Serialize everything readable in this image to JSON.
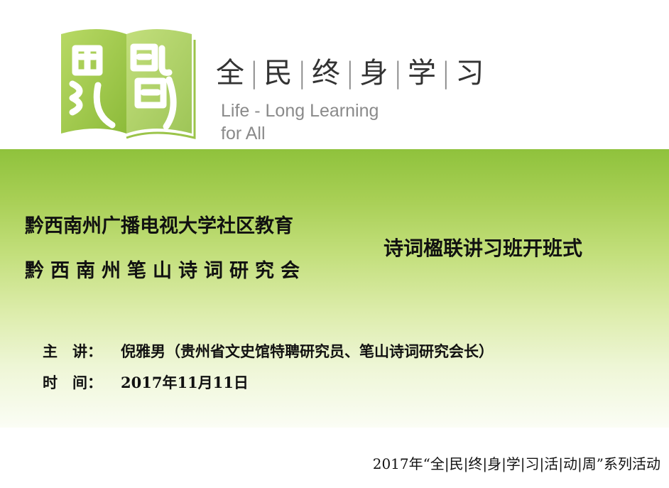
{
  "header": {
    "slogan_chars": [
      "全",
      "民",
      "终",
      "身",
      "学",
      "习"
    ],
    "english_line1": "Life - Long Learning",
    "english_line2": "for All",
    "logo_icon": "book-logo-icon",
    "colors": {
      "logo_green": "#9bc44a",
      "logo_light": "#c9e27a",
      "band_top": "#8fc23c"
    }
  },
  "title": {
    "org_line1": "黔西南州广播电视大学社区教育",
    "org_line2": "黔西南州笔山诗词研究会",
    "event": "诗词楹联讲习班开班式"
  },
  "info": {
    "speaker_label": "主　讲：",
    "speaker_value": "倪雅男（贵州省文史馆特聘研究员、笔山诗词研究会长）",
    "time_label": "时　间：",
    "time_value": "2017年11月11日"
  },
  "footer": {
    "text": "2017年“全|民|终|身|学|习|活|动|周”系列活动"
  }
}
